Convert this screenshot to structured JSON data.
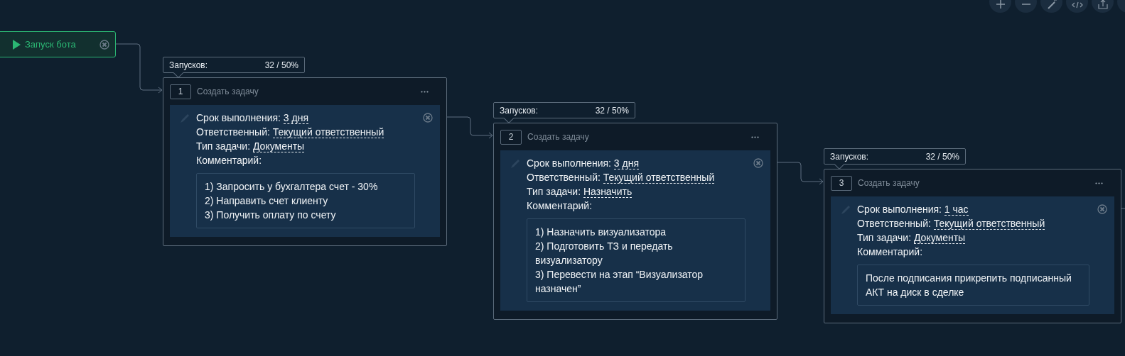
{
  "start_node": {
    "label": "Запуск бота"
  },
  "tasks": [
    {
      "stats_label": "Запусков:",
      "stats_value": "32 / 50%",
      "number": "1",
      "title": "Создать задачу",
      "fields": [
        {
          "label": "Срок выполнения:",
          "value": "3 дня"
        },
        {
          "label": "Ответственный:",
          "value": "Текущий ответственный"
        },
        {
          "label": "Тип задачи:",
          "value": "Документы"
        }
      ],
      "comment_label": "Комментарий:",
      "comment": [
        "1) Запросить у бухгалтера счет - 30%",
        "2) Направить счет клиенту",
        "3) Получить оплату по счету"
      ]
    },
    {
      "stats_label": "Запусков:",
      "stats_value": "32 / 50%",
      "number": "2",
      "title": "Создать задачу",
      "fields": [
        {
          "label": "Срок выполнения:",
          "value": "3 дня"
        },
        {
          "label": "Ответственный:",
          "value": "Текущий ответственный"
        },
        {
          "label": "Тип задачи:",
          "value": "Назначить"
        }
      ],
      "comment_label": "Комментарий:",
      "comment": [
        "1) Назначить визуализатора",
        "2) Подготовить ТЗ и передать визуализатору",
        "3) Перевести на этап “Визуализатор назначен”"
      ]
    },
    {
      "stats_label": "Запусков:",
      "stats_value": "32 / 50%",
      "number": "3",
      "title": "Создать задачу",
      "fields": [
        {
          "label": "Срок выполнения:",
          "value": "1 час"
        },
        {
          "label": "Ответственный:",
          "value": "Текущий ответственный"
        },
        {
          "label": "Тип задачи:",
          "value": "Документы"
        }
      ],
      "comment_label": "Комментарий:",
      "comment": [
        "После подписания прикрепить подписанный АКТ на диск в сделке"
      ]
    }
  ]
}
